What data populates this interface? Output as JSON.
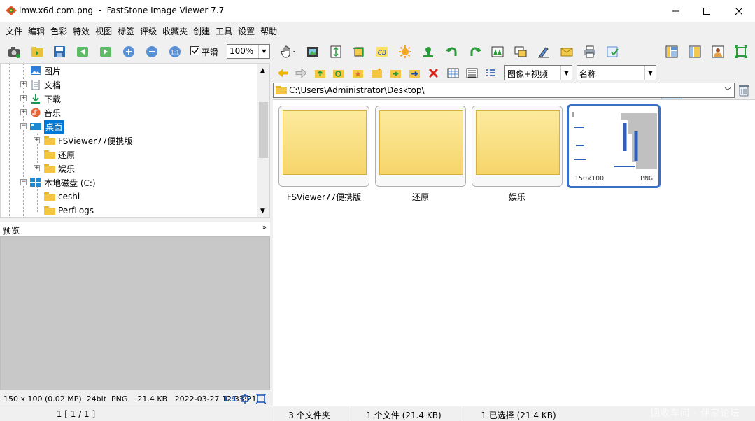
{
  "window": {
    "title": "lmw.x6d.com.png  -  FastStone Image Viewer 7.7",
    "title_prefix": "e"
  },
  "menu": [
    "文件",
    "编辑",
    "色彩",
    "特效",
    "视图",
    "标签",
    "评级",
    "收藏夹",
    "创建",
    "工具",
    "设置",
    "帮助"
  ],
  "toolbar": {
    "smooth_label": "平滑",
    "smooth_checked": true,
    "zoom_value": "100%"
  },
  "tree": {
    "items": [
      {
        "label": "图片",
        "icon": "pictures-icon"
      },
      {
        "label": "文档",
        "icon": "documents-icon"
      },
      {
        "label": "下载",
        "icon": "downloads-icon"
      },
      {
        "label": "音乐",
        "icon": "music-icon"
      },
      {
        "label": "桌面",
        "icon": "desktop-icon",
        "selected": true
      },
      {
        "label": "FSViewer77便携版",
        "icon": "folder-icon"
      },
      {
        "label": "还原",
        "icon": "folder-icon"
      },
      {
        "label": "娱乐",
        "icon": "folder-icon"
      },
      {
        "label": "本地磁盘 (C:)",
        "icon": "drive-icon"
      },
      {
        "label": "ceshi",
        "icon": "folder-icon"
      },
      {
        "label": "PerfLogs",
        "icon": "folder-icon"
      }
    ]
  },
  "preview": {
    "label": "预览",
    "info": "150 x 100 (0.02 MP)  24bit  PNG    21.4 KB   2022-03-27 12:33:21",
    "ratio": "1:1"
  },
  "browser": {
    "filter_value": "图像+视频",
    "sort_value": "名称",
    "path": "C:\\Users\\Administrator\\Desktop\\",
    "thumbnails": [
      {
        "label": "FSViewer77便携版",
        "type": "folder"
      },
      {
        "label": "还原",
        "type": "folder"
      },
      {
        "label": "娱乐",
        "type": "folder"
      },
      {
        "label": "",
        "type": "image",
        "dims": "150x100",
        "format": "PNG",
        "selected": true
      }
    ]
  },
  "status": {
    "page": "1 [ 1 / 1 ]",
    "folders": "3 个文件夹",
    "files": "1 个文件 (21.4 KB)",
    "selected": "1 已选择 (21.4 KB)"
  },
  "watermark": "回收车间 · 伴家论坛",
  "colors": {
    "accent": "#0078d7",
    "selection_border": "#3a70c8",
    "folder_yellow": "#f6d56a"
  }
}
